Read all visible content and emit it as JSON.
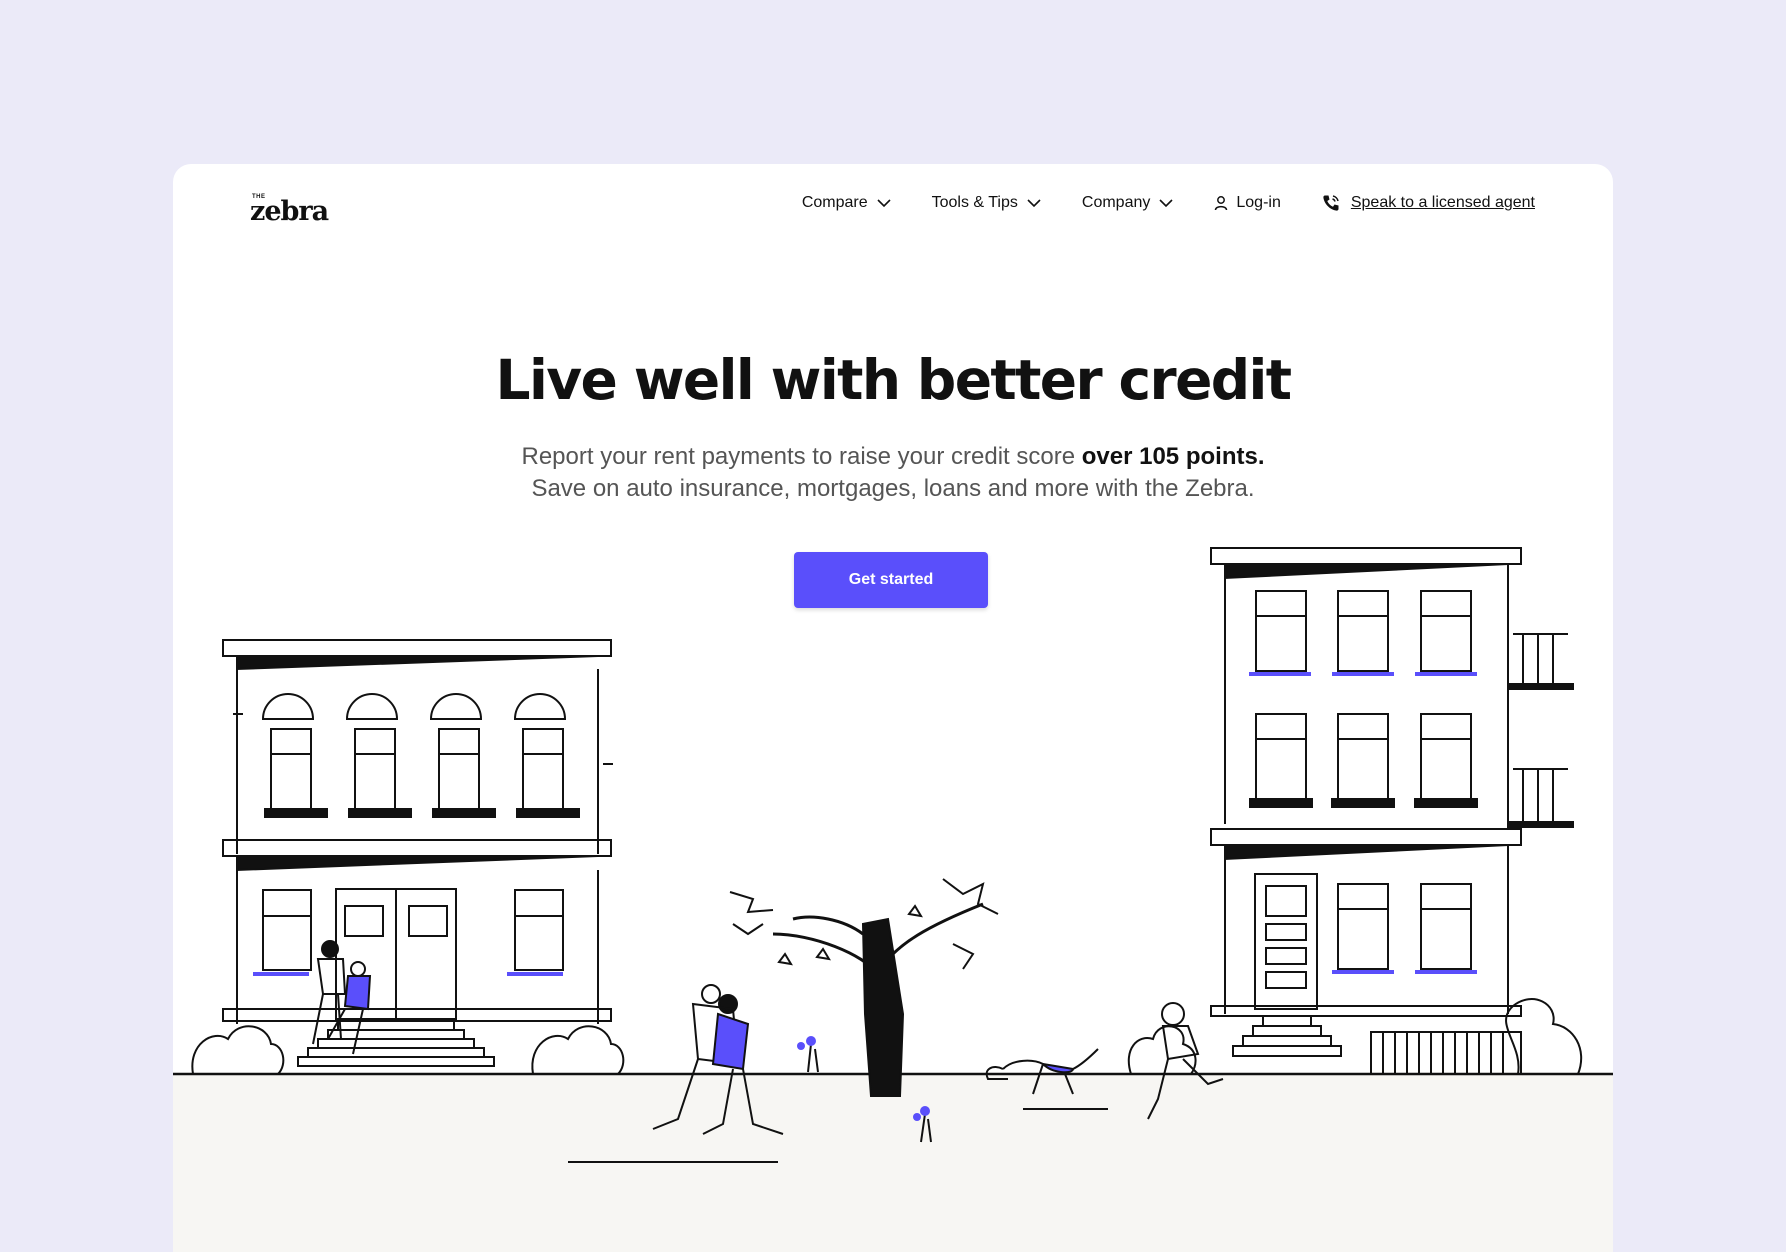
{
  "brand": {
    "logo_small": "THE",
    "logo_word": "zebra"
  },
  "nav": {
    "items": [
      {
        "label": "Compare",
        "icon": "chevron-down-icon"
      },
      {
        "label": "Tools & Tips",
        "icon": "chevron-down-icon"
      },
      {
        "label": "Company",
        "icon": "chevron-down-icon"
      }
    ],
    "login": {
      "label": "Log-in",
      "icon": "user-icon"
    },
    "agent": {
      "label": "Speak to a licensed agent",
      "icon": "phone-icon"
    }
  },
  "hero": {
    "title": "Live well with better credit",
    "subtitle_1_prefix": "Report your rent payments to raise your credit score ",
    "subtitle_1_emphasis": "over 105 points.",
    "subtitle_2": "Save on auto insurance, mortgages, loans and more with the Zebra.",
    "cta_label": "Get started"
  },
  "colors": {
    "page_background": "#ebeaf8",
    "card_background": "#ffffff",
    "accent": "#5a4ffb",
    "ground": "#f7f6f3",
    "ink": "#111111"
  }
}
